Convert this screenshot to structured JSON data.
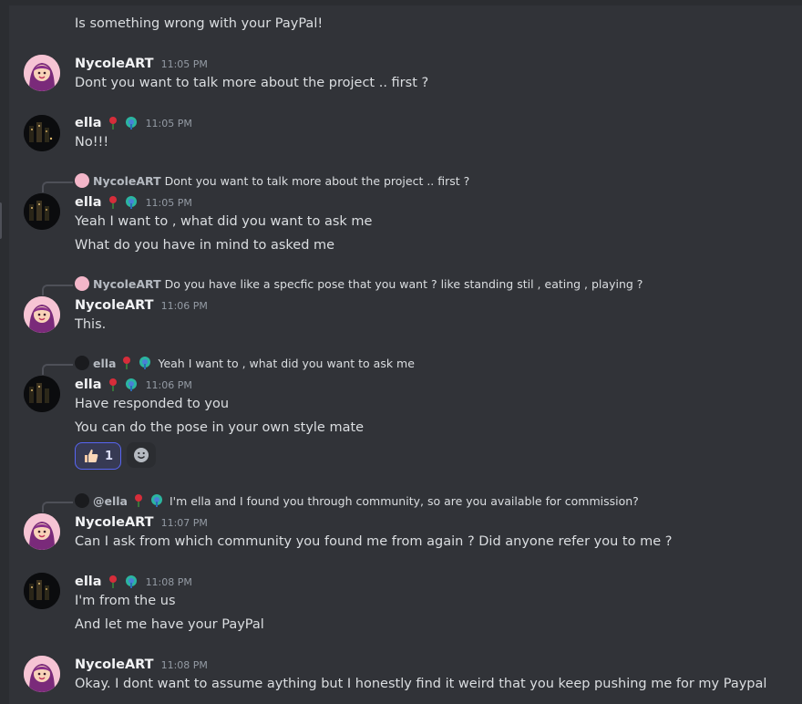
{
  "colors": {
    "background": "#313338",
    "username": "#f2f3f5",
    "timestamp": "#949ba4",
    "reaction_border": "#5865f2"
  },
  "messages": [
    {
      "lines": [
        "Is something wrong with your PayPal!"
      ]
    },
    {
      "author": "NycoleART",
      "time": "11:05 PM",
      "lines": [
        "Dont you want to talk more about the project .. first ?"
      ]
    },
    {
      "author": "ella",
      "time": "11:05 PM",
      "lines": [
        "No!!!"
      ]
    },
    {
      "reply": {
        "name": "NycoleART",
        "text": "Dont you want to talk more about the project .. first ?"
      },
      "author": "ella",
      "time": "11:05 PM",
      "lines": [
        "Yeah I want to , what did you want to ask me",
        "What do you have in mind to asked me"
      ]
    },
    {
      "reply": {
        "name": "NycoleART",
        "text": "Do you have like a specfic pose that you want ? like standing stil , eating , playing ?"
      },
      "author": "NycoleART",
      "time": "11:06 PM",
      "lines": [
        "This."
      ]
    },
    {
      "reply": {
        "name": "ella",
        "text": "Yeah I want to , what did you want to ask me"
      },
      "author": "ella",
      "time": "11:06 PM",
      "lines": [
        "Have responded to you",
        "You can do the pose in your own style mate"
      ],
      "reaction": {
        "emoji": "thumbs-up-icon",
        "count": "1"
      }
    },
    {
      "reply": {
        "name": "@ella",
        "text": "I'm ella and I found you through community,  so are you available for commission?"
      },
      "author": "NycoleART",
      "time": "11:07 PM",
      "lines": [
        "Can I ask from which community you found me from again ? Did anyone refer you to me ?"
      ]
    },
    {
      "author": "ella",
      "time": "11:08 PM",
      "lines": [
        "I'm from the us",
        "And let me have your PayPal"
      ]
    },
    {
      "author": "NycoleART",
      "time": "11:08 PM",
      "lines": [
        "Okay. I dont want to assume aything but I honestly find it weird that you keep pushing me for my Paypal"
      ]
    }
  ]
}
